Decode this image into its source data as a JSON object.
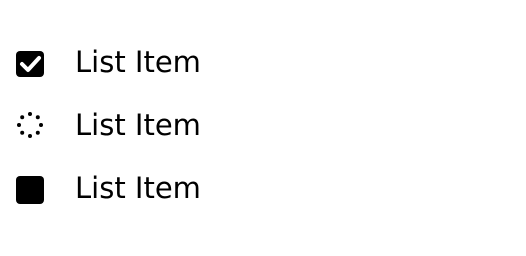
{
  "list": {
    "items": [
      {
        "label": "List Item",
        "icon": "checkbox-checked-icon"
      },
      {
        "label": "List Item",
        "icon": "loading-spinner-icon"
      },
      {
        "label": "List Item",
        "icon": "stop-square-icon"
      }
    ]
  },
  "colors": {
    "text": "#000000",
    "icon": "#000000",
    "background": "#ffffff"
  }
}
